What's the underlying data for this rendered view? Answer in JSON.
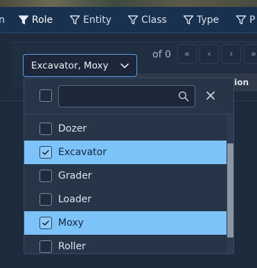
{
  "filter_bar": {
    "items": [
      {
        "label": "n",
        "icon": "filter-icon"
      },
      {
        "label": "Role",
        "icon": "filter-icon"
      },
      {
        "label": "Entity",
        "icon": "filter-icon"
      },
      {
        "label": "Class",
        "icon": "filter-icon"
      },
      {
        "label": "Type",
        "icon": "filter-icon"
      },
      {
        "label": "P",
        "icon": "filter-icon"
      }
    ]
  },
  "select": {
    "value": "Excavator, Moxy",
    "icon": "chevron-down-icon"
  },
  "pager": {
    "text": "of 0",
    "first": "«",
    "prev": "‹",
    "next": "›",
    "last": "»"
  },
  "table": {
    "header_partial": "tion"
  },
  "dropdown": {
    "search_value": "",
    "search_icon": "search-icon",
    "close_icon": "close-icon",
    "options": [
      {
        "label": "Dozer",
        "checked": false
      },
      {
        "label": "Excavator",
        "checked": true
      },
      {
        "label": "Grader",
        "checked": false
      },
      {
        "label": "Loader",
        "checked": false
      },
      {
        "label": "Moxy",
        "checked": true
      },
      {
        "label": "Roller",
        "checked": false
      }
    ]
  },
  "colors": {
    "header_bg": "#17314f",
    "selected_row": "#7cc3fa",
    "accent_border": "#5aa0e6"
  }
}
